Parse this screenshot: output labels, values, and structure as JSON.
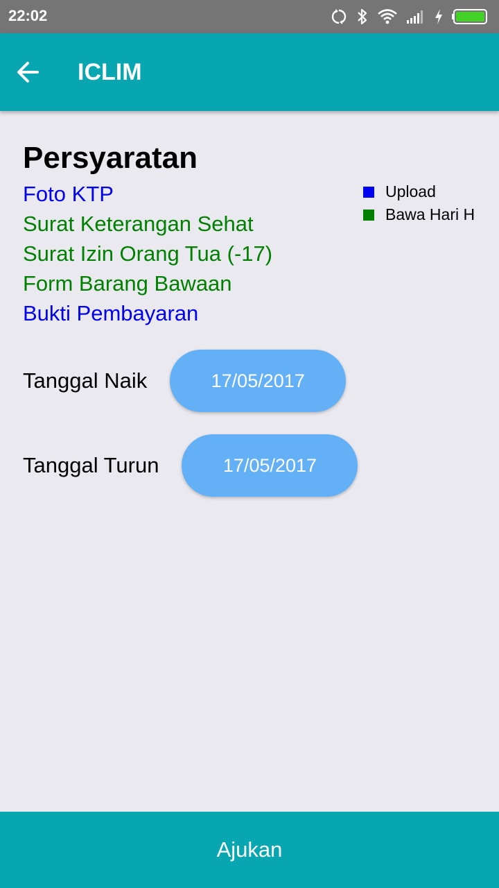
{
  "status_bar": {
    "time": "22:02",
    "icons": [
      "sync-icon",
      "bluetooth-icon",
      "wifi-icon",
      "signal-icon",
      "charging-icon",
      "battery-icon"
    ]
  },
  "app_bar": {
    "title": "ICLIM",
    "back_icon": "arrow-left-icon"
  },
  "requirements": {
    "heading": "Persyaratan",
    "items": [
      {
        "label": "Foto KTP",
        "color": "#0000ee"
      },
      {
        "label": "Surat Keterangan Sehat",
        "color": "#008000"
      },
      {
        "label": "Surat Izin Orang Tua (-17)",
        "color": "#008000"
      },
      {
        "label": "Form Barang Bawaan",
        "color": "#008000"
      },
      {
        "label": "Bukti Pembayaran",
        "color": "#0000ee"
      }
    ]
  },
  "legend": [
    {
      "label": "Upload",
      "color": "#0000ee"
    },
    {
      "label": "Bawa Hari H",
      "color": "#008000"
    }
  ],
  "dates": {
    "naik": {
      "label": "Tanggal Naik",
      "value": "17/05/2017"
    },
    "turun": {
      "label": "Tanggal Turun",
      "value": "17/05/2017"
    }
  },
  "submit": {
    "label": "Ajukan"
  },
  "colors": {
    "primary": "#07a6b0",
    "date_button": "#64b0f6",
    "background": "#e9e9ef",
    "status_bar": "#757575"
  }
}
